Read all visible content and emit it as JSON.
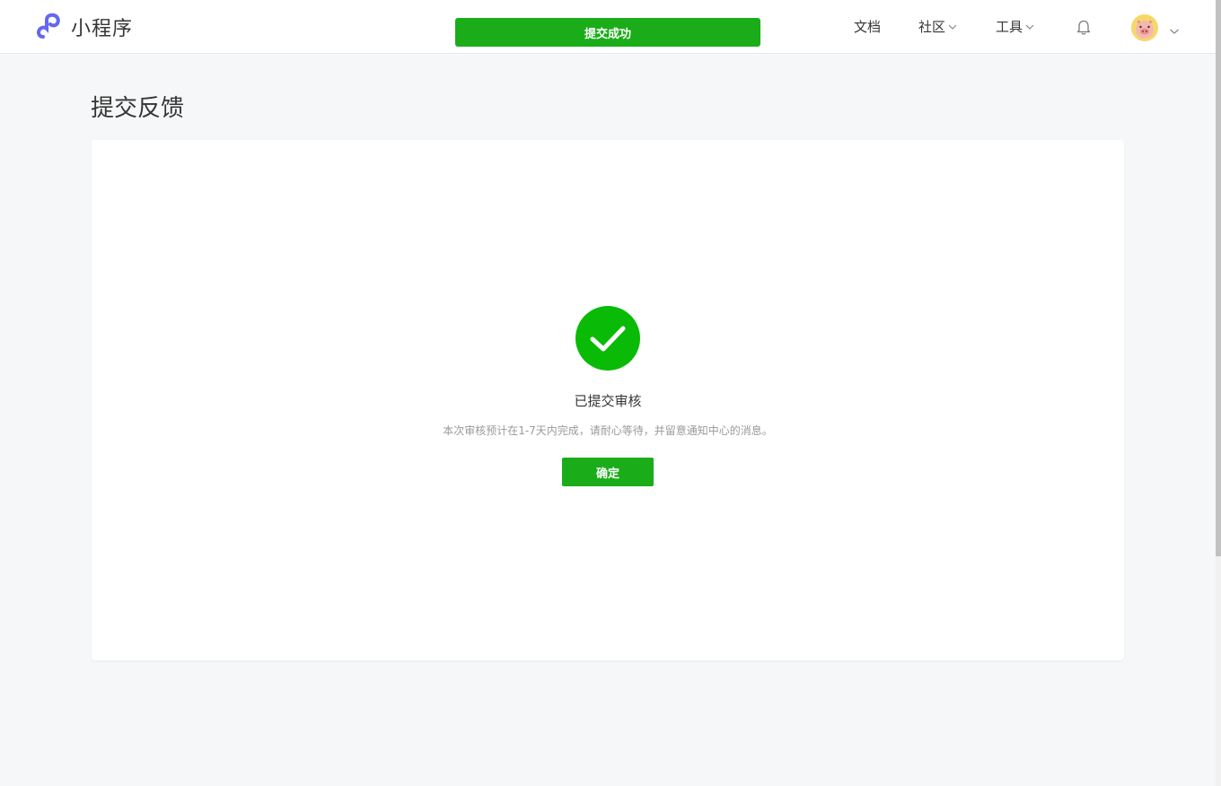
{
  "header": {
    "logo_text": "小程序",
    "toast_text": "提交成功",
    "nav": {
      "docs": "文档",
      "community": "社区",
      "tools": "工具"
    },
    "icons": {
      "logo": "mini-program-logo-icon",
      "bell": "bell-icon",
      "avatar": "user-avatar",
      "chevron": "chevron-down-icon"
    }
  },
  "page": {
    "title": "提交反馈"
  },
  "result": {
    "icon": "checkmark-circle-icon",
    "title": "已提交审核",
    "description": "本次审核预计在1-7天内完成，请耐心等待，并留意通知中心的消息。",
    "confirm_label": "确定"
  },
  "colors": {
    "brand_green": "#1aad19",
    "success_green": "#09bb07",
    "logo_purple": "#6467f0"
  }
}
